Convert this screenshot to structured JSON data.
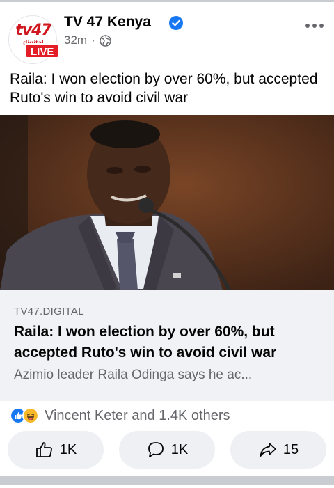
{
  "page": {
    "name": "TV 47 Kenya",
    "time": "32m",
    "separator": "·",
    "logo_text": "tv47",
    "logo_subtext": "digital",
    "live_badge": "LIVE"
  },
  "post": {
    "text": "Raila: I won election by over 60%, but accepted Ruto's win to avoid civil war"
  },
  "link_preview": {
    "domain": "TV47.DIGITAL",
    "title": "Raila: I won election by over 60%, but accepted Ruto's win to avoid civil war",
    "description": "Azimio leader Raila Odinga says he ac..."
  },
  "reactions": {
    "summary": "Vincent Keter and 1.4K others",
    "icons": [
      "like-reaction-icon",
      "haha-reaction-icon"
    ]
  },
  "actions": {
    "like_count": "1K",
    "comment_count": "1K",
    "share_count": "15"
  },
  "colors": {
    "brand_blue": "#1877f2",
    "live_red": "#e41e26",
    "muted_text": "#65676b",
    "link_bg": "#f0f2f5"
  }
}
